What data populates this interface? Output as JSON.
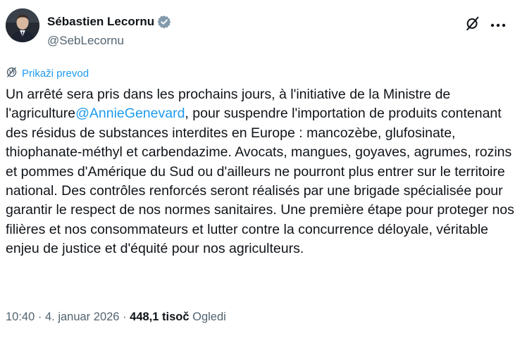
{
  "author": {
    "name": "Sébastien Lecornu",
    "handle": "@SebLecornu",
    "verified_color": "#829aab"
  },
  "actions": {
    "grok_icon": "grok-icon",
    "more_icon": "more-icon"
  },
  "translate": {
    "label": "Prikaži prevod",
    "icon": "globe-icon"
  },
  "tweet": {
    "text_before": "Un arrêté sera pris dans les prochains jours, à l'initiative de la Ministre de l'agriculture",
    "mention": "@AnnieGenevard",
    "text_after": ", pour suspendre l'importation de produits contenant des résidus de substances interdites en Europe : mancozèbe, glufosinate, thiophanate-méthyl et carbendazime. Avocats, mangues, goyaves, agrumes, rozins et pommes d'Amérique du Sud ou d'ailleurs ne pourront plus entrer sur le territoire national. Des contrôles renforcés seront réalisés par une brigade spécialisée pour garantir le respect de nos normes sanitaires. Une première étape pour proteger nos filières et nos consommateurs et lutter contre la concurrence déloyale, véritable enjeu de justice et d'équité pour nos agriculteurs."
  },
  "meta": {
    "time": "10:40",
    "separator": " · ",
    "date": "4. januar 2026",
    "views_count": "448,1 tisoč",
    "views_label": " Ogledi"
  },
  "colors": {
    "text": "#0f1419",
    "secondary": "#536471",
    "link": "#1d9bf0"
  }
}
